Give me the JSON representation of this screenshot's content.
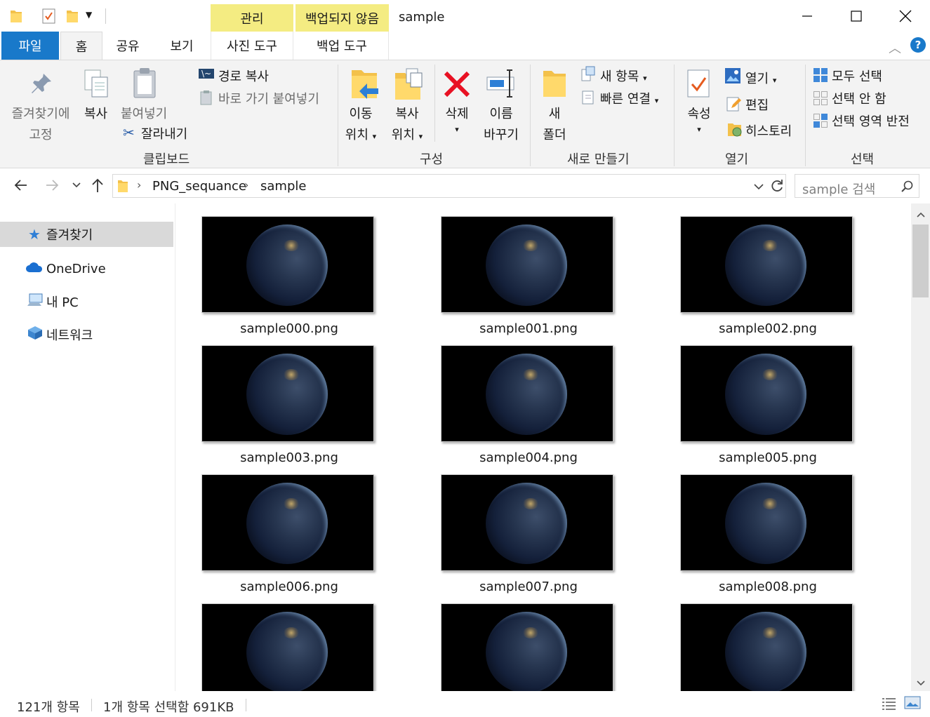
{
  "titlebar": {
    "title": "sample",
    "context_tabs": {
      "manage": "관리",
      "not_backed_up": "백업되지 않음"
    }
  },
  "tabs": {
    "file": "파일",
    "home": "홈",
    "share": "공유",
    "view": "보기",
    "picture_tools": "사진 도구",
    "backup_tools": "백업 도구"
  },
  "ribbon": {
    "clipboard": {
      "pin_line1": "즐겨찾기에",
      "pin_line2": "고정",
      "copy": "복사",
      "paste": "붙여넣기",
      "copy_path": "경로 복사",
      "paste_shortcut": "바로 가기 붙여넣기",
      "cut": "잘라내기",
      "group": "클립보드"
    },
    "organize": {
      "move_line1": "이동",
      "move_line2": "위치",
      "copyto_line1": "복사",
      "copyto_line2": "위치",
      "delete": "삭제",
      "rename_line1": "이름",
      "rename_line2": "바꾸기",
      "group": "구성"
    },
    "new": {
      "folder_line1": "새",
      "folder_line2": "폴더",
      "new_item": "새 항목",
      "easy_access": "빠른 연결",
      "group": "새로 만들기"
    },
    "open": {
      "properties": "속성",
      "open": "열기",
      "edit": "편집",
      "history": "히스토리",
      "group": "열기"
    },
    "select": {
      "select_all": "모두 선택",
      "select_none": "선택 안 함",
      "invert": "선택 영역 반전",
      "group": "선택"
    }
  },
  "address": {
    "crumbs": [
      "PNG_sequance",
      "sample"
    ],
    "search_placeholder": "sample 검색"
  },
  "nav": {
    "items": [
      "즐겨찾기",
      "OneDrive",
      "내 PC",
      "네트워크"
    ]
  },
  "files": [
    "sample000.png",
    "sample001.png",
    "sample002.png",
    "sample003.png",
    "sample004.png",
    "sample005.png",
    "sample006.png",
    "sample007.png",
    "sample008.png",
    "",
    "",
    ""
  ],
  "status": {
    "count": "121개 항목",
    "selection": "1개 항목 선택함 691KB"
  },
  "colors": {
    "file_tab": "#1979ca",
    "context_tab": "#f4ec82",
    "nav_selected": "#d9d9d9",
    "delete_red": "#e81123"
  }
}
